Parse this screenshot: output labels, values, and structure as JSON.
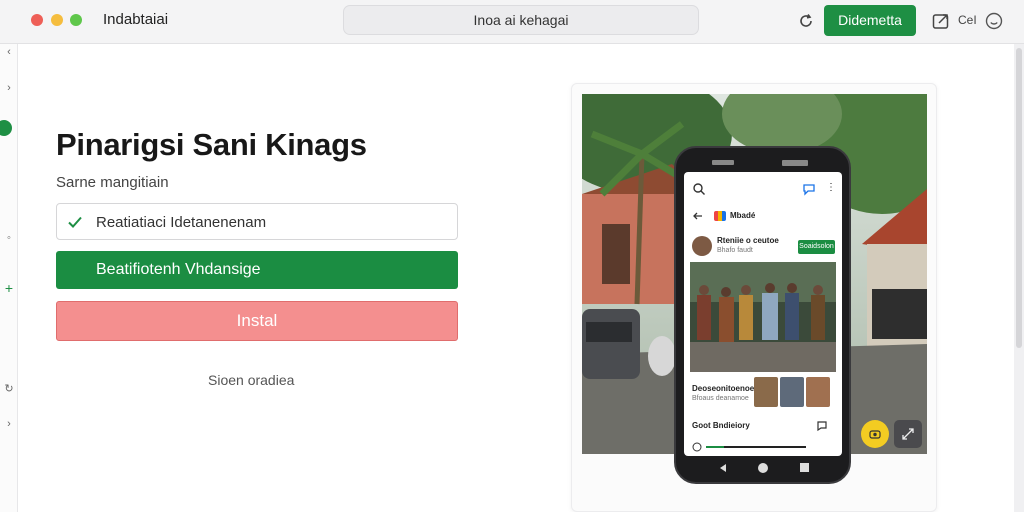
{
  "window": {
    "title": "Indabtaiai",
    "address": "Inoa ai kehagai",
    "primary_button": "Didemetta",
    "mini_label": "CeI"
  },
  "main": {
    "heading": "Pinarigsi Sani Kinags",
    "subtitle": "Sarne mangitiain",
    "checked_item": "Reatiatiaci Idetanenenam",
    "green_button": "Beatifiotenh Vhdansige",
    "red_button": "Instal",
    "link": "Sioen oradiea"
  },
  "phone": {
    "app_name": "Mbadé",
    "post_author": "Rteniie o ceutoe",
    "post_sub": "Bhafo faudt",
    "follow_label": "Soaidsolon",
    "caption": "Deoseonitoenoe",
    "caption_sub": "Bfoaus deanamoe",
    "comment_label": "Goot Bndieiory"
  },
  "colors": {
    "accent_green": "#1e8f44",
    "danger_red": "#f48f8f",
    "fab_yellow": "#f3cc22"
  },
  "icons": {
    "refresh": "refresh-icon",
    "share": "share-icon",
    "smile": "smile-icon",
    "check": "check-icon",
    "search": "search-icon",
    "back": "back-arrow-icon"
  }
}
